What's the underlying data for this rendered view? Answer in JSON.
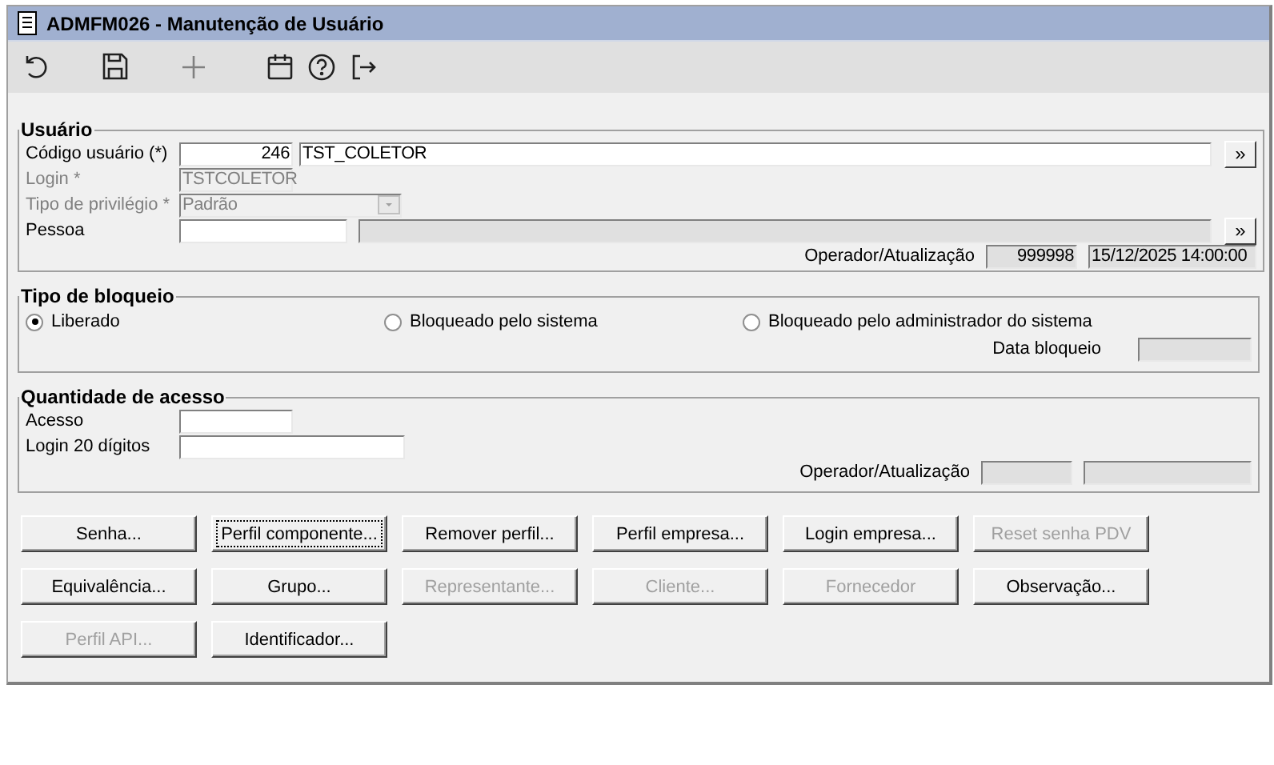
{
  "window": {
    "title": "ADMFM026 - Manutenção de Usuário"
  },
  "toolbar": [
    {
      "kind": "undo",
      "disabled": false
    },
    {
      "kind": "save",
      "disabled": false
    },
    {
      "kind": "add",
      "disabled": true
    },
    {
      "kind": "calendar",
      "disabled": false
    },
    {
      "kind": "help",
      "disabled": false
    },
    {
      "kind": "exit",
      "disabled": false
    }
  ],
  "usuario": {
    "legend": "Usuário",
    "codigo": {
      "label": "Código usuário (*)",
      "value": "246",
      "name": "TST_COLETOR"
    },
    "login": {
      "label": "Login *",
      "value": "TSTCOLETOR",
      "disabled": true
    },
    "privilegio": {
      "label": "Tipo de privilégio *",
      "value": "Padrão",
      "disabled": true
    },
    "pessoa": {
      "label": "Pessoa"
    },
    "lookup_button": "»",
    "operador": {
      "label": "Operador/Atualização",
      "code": "999998",
      "date": "15/12/2025 14:00:00"
    }
  },
  "bloqueio": {
    "legend": "Tipo de bloqueio",
    "options": [
      {
        "label": "Liberado",
        "selected": true
      },
      {
        "label": "Bloqueado pelo sistema",
        "selected": false
      },
      {
        "label": "Bloqueado pelo administrador do sistema",
        "selected": false
      }
    ],
    "data_label": "Data bloqueio"
  },
  "acesso": {
    "legend": "Quantidade de acesso",
    "acesso_label": "Acesso",
    "login20_label": "Login 20 dígitos",
    "operador_label": "Operador/Atualização"
  },
  "buttons": [
    [
      {
        "label": "Senha...",
        "disabled": false,
        "focused": false
      },
      {
        "label": "Perfil componente...",
        "disabled": false,
        "focused": true
      },
      {
        "label": "Remover perfil...",
        "disabled": false,
        "focused": false
      },
      {
        "label": "Perfil empresa...",
        "disabled": false,
        "focused": false
      },
      {
        "label": "Login empresa...",
        "disabled": false,
        "focused": false
      },
      {
        "label": "Reset senha PDV",
        "disabled": true,
        "focused": false
      }
    ],
    [
      {
        "label": "Equivalência...",
        "disabled": false,
        "focused": false
      },
      {
        "label": "Grupo...",
        "disabled": false,
        "focused": false
      },
      {
        "label": "Representante...",
        "disabled": true,
        "focused": false
      },
      {
        "label": "Cliente...",
        "disabled": true,
        "focused": false
      },
      {
        "label": "Fornecedor",
        "disabled": true,
        "focused": false
      },
      {
        "label": "Observação...",
        "disabled": false,
        "focused": false
      }
    ],
    [
      {
        "label": "Perfil API...",
        "disabled": true,
        "focused": false
      },
      {
        "label": "Identificador...",
        "disabled": false,
        "focused": false
      }
    ]
  ]
}
